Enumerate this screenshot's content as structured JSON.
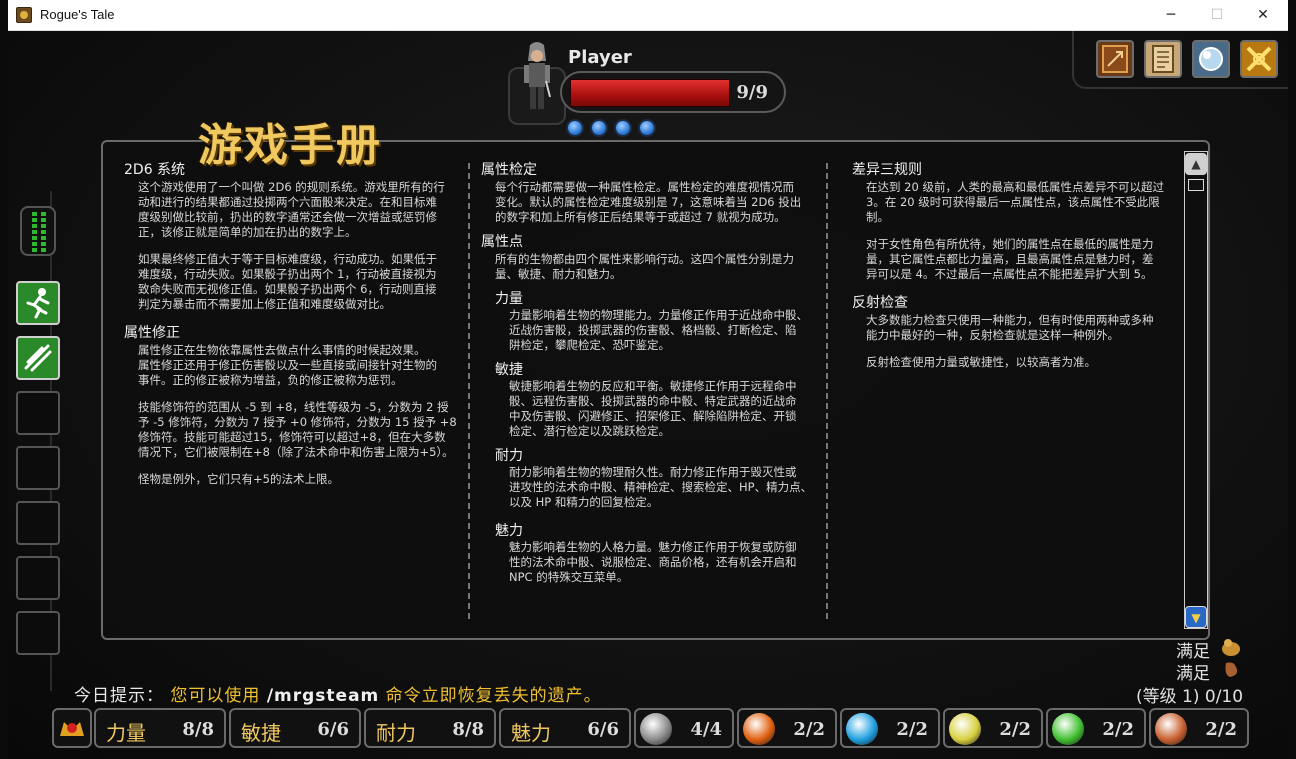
{
  "window": {
    "title": "Rogue's Tale",
    "minimize": "─",
    "maximize": "☐",
    "close": "✕"
  },
  "player": {
    "name": "Player",
    "hp_text": "9/9",
    "hp_fraction": 1.0,
    "mana_dots": 4
  },
  "top_icons": [
    "spellbook-icon",
    "scroll-map-icon",
    "orb-icon",
    "crossed-swords-icon"
  ],
  "manual": {
    "title": "游戏手册",
    "col1": {
      "s1_title": "2D6 系统",
      "s1_p1": "这个游戏使用了一个叫做 2D6 的规则系统。游戏里所有的行\n动和进行的结果都通过投掷两个六面骰来决定。在和目标难\n度级别做比较前，扔出的数字通常还会做一次增益或惩罚修\n正，该修正就是简单的加在扔出的数字上。",
      "s1_p2": "如果最终修正值大于等于目标难度级，行动成功。如果低于\n难度级，行动失败。如果骰子扔出两个 1，行动被直接视为\n致命失败而无视修正值。如果骰子扔出两个 6，行动则直接\n判定为暴击而不需要加上修正值和难度级做对比。",
      "s2_title": "属性修正",
      "s2_p1": "属性修正在生物依靠属性去做点什么事情的时候起效果。\n属性修正还用于修正伤害骰以及一些直接或间接针对生物的\n事件。正的修正被称为增益，负的修正被称为惩罚。",
      "s2_p2": "技能修饰符的范围从 -5 到 +8，线性等级为 -5，分数为 2 授\n予 -5 修饰符，分数为 7 授予 +0 修饰符，分数为 15 授予 +8\n修饰符。技能可能超过15，修饰符可以超过+8，但在大多数\n情况下，它们被限制在+8（除了法术命中和伤害上限为+5）。",
      "s2_p3": "怪物是例外，它们只有+5的法术上限。"
    },
    "col2": {
      "s1_title": "属性检定",
      "s1_p1": "每个行动都需要做一种属性检定。属性检定的难度视情况而\n变化。默认的属性检定难度级别是 7，这意味着当 2D6 投出\n的数字和加上所有修正后结果等于或超过 7 就视为成功。",
      "s2_title": "属性点",
      "s2_p1": "所有的生物都由四个属性来影响行动。这四个属性分别是力\n量、敏捷、耐力和魅力。",
      "str_title": "力量",
      "str_p": "力量影响着生物的物理能力。力量修正作用于近战命中骰、\n近战伤害骰，投掷武器的伤害骰、格档骰、打断检定、陷\n阱检定，攀爬检定、恐吓鉴定。",
      "dex_title": "敏捷",
      "dex_p": "敏捷影响着生物的反应和平衡。敏捷修正作用于远程命中\n骰、远程伤害骰、投掷武器的命中骰、特定武器的近战命\n中及伤害骰、闪避修正、招架修正、解除陷阱检定、开锁\n检定、潜行检定以及跳跃检定。",
      "con_title": "耐力",
      "con_p": "耐力影响着生物的物理耐久性。耐力修正作用于毁灭性或\n进攻性的法术命中骰、精神检定、搜索检定、HP、精力点、\n以及 HP 和精力的回复检定。",
      "cha_title": "魅力",
      "cha_p": "魅力影响着生物的人格力量。魅力修正作用于恢复或防御\n性的法术命中骰、说服检定、商品价格，还有机会开启和\nNPC 的特殊交互菜单。"
    },
    "col3": {
      "s1_title": "差异三规则",
      "s1_p1": "在达到 20 级前，人类的最高和最低属性点差异不可以超过\n3。在 20 级时可获得最后一点属性点，该点属性不受此限\n制。",
      "s1_p2": "对于女性角色有所优待，她们的属性点在最低的属性是力\n量，其它属性点都比力量高，且最高属性点是魅力时，差\n异可以是 4。不过最后一点属性点不能把差异扩大到 5。",
      "s2_title": "反射检查",
      "s2_p1": "大多数能力检查只使用一种能力，但有时使用两种或多种\n能力中最好的一种，反射检查就是这样一种例外。",
      "s2_p2": "反射检查使用力量或敏捷性，以较高者为准。"
    },
    "scroll_up": "▲",
    "scroll_down": "▼"
  },
  "left_skills": [
    "running-man-icon",
    "wing-slash-icon",
    "",
    "",
    "",
    "",
    "",
    ""
  ],
  "status": {
    "satiety_1": "满足",
    "satiety_2": "满足",
    "level": "(等级 1) 0/10"
  },
  "tip": {
    "prefix": "今日提示：",
    "part1": "您可以使用",
    "command": "/mrgsteam",
    "part2": "命令立即恢复丢失的遗产。"
  },
  "stats": [
    {
      "label": "力量",
      "value": "8/8"
    },
    {
      "label": "敏捷",
      "value": "6/6"
    },
    {
      "label": "耐力",
      "value": "8/8"
    },
    {
      "label": "魅力",
      "value": "6/6"
    }
  ],
  "resources": [
    {
      "icon": "dragon-icon",
      "value": "4/4",
      "color": "#8a8a8a"
    },
    {
      "icon": "fire-orb-icon",
      "value": "2/2",
      "color": "#e06010"
    },
    {
      "icon": "water-orb-icon",
      "value": "2/2",
      "color": "#20a0e0"
    },
    {
      "icon": "air-orb-icon",
      "value": "2/2",
      "color": "#d8d040"
    },
    {
      "icon": "earth-orb-icon",
      "value": "2/2",
      "color": "#40c030"
    },
    {
      "icon": "spirit-orb-icon",
      "value": "2/2",
      "color": "#c86030"
    }
  ]
}
